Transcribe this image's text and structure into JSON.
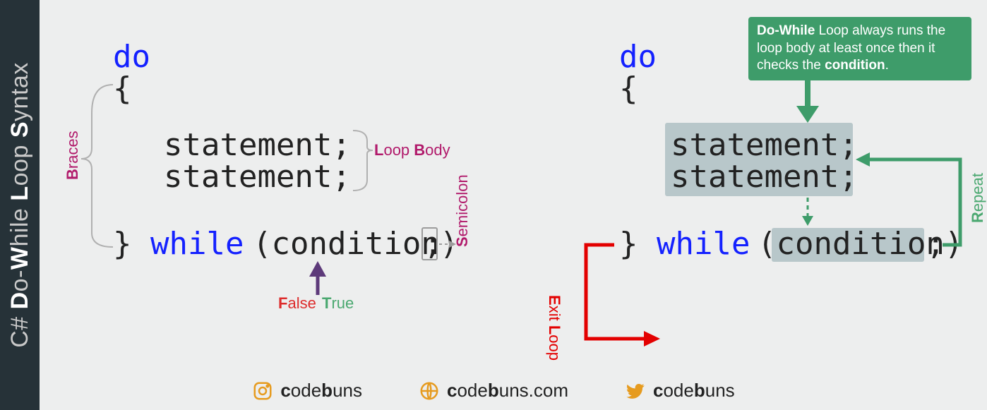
{
  "sidebar": {
    "prefix": "C# ",
    "w1a": "D",
    "w1b": "o-",
    "w2a": "W",
    "w2b": "hile ",
    "w3a": "L",
    "w3b": "oop ",
    "w4a": "S",
    "w4b": "yntax"
  },
  "left": {
    "do": "do",
    "open": "{",
    "stmt1": "statement;",
    "stmt2": "statement;",
    "close": "}",
    "while": "while",
    "cond": "(condition)",
    "semi": ";"
  },
  "right": {
    "do": "do",
    "open": "{",
    "stmt1": "statement;",
    "stmt2": "statement;",
    "close": "}",
    "while": "while",
    "cond": "(condition)",
    "semi": ";"
  },
  "labels": {
    "braces_b": "B",
    "braces_r": "races",
    "loopbody_l": "L",
    "loopbody_lr": "oop ",
    "loopbody_b": "B",
    "loopbody_br": "ody",
    "semi_s": "S",
    "semi_r": "emicolon",
    "false_f": "F",
    "false_r": "alse",
    "true_t": "T",
    "true_r": "rue",
    "exit_e": "E",
    "exit_er": "xit ",
    "exit_l": "L",
    "exit_lr": "oop",
    "repeat_r": "R",
    "repeat_rr": "epeat"
  },
  "callout": {
    "p1a": "Do-While",
    "p1b": " Loop always runs the loop body at least once then it checks the ",
    "p2a": "condition",
    "p2b": "."
  },
  "footer": {
    "ig": "codebuns",
    "web": "codebuns.com",
    "tw": "codebuns"
  }
}
